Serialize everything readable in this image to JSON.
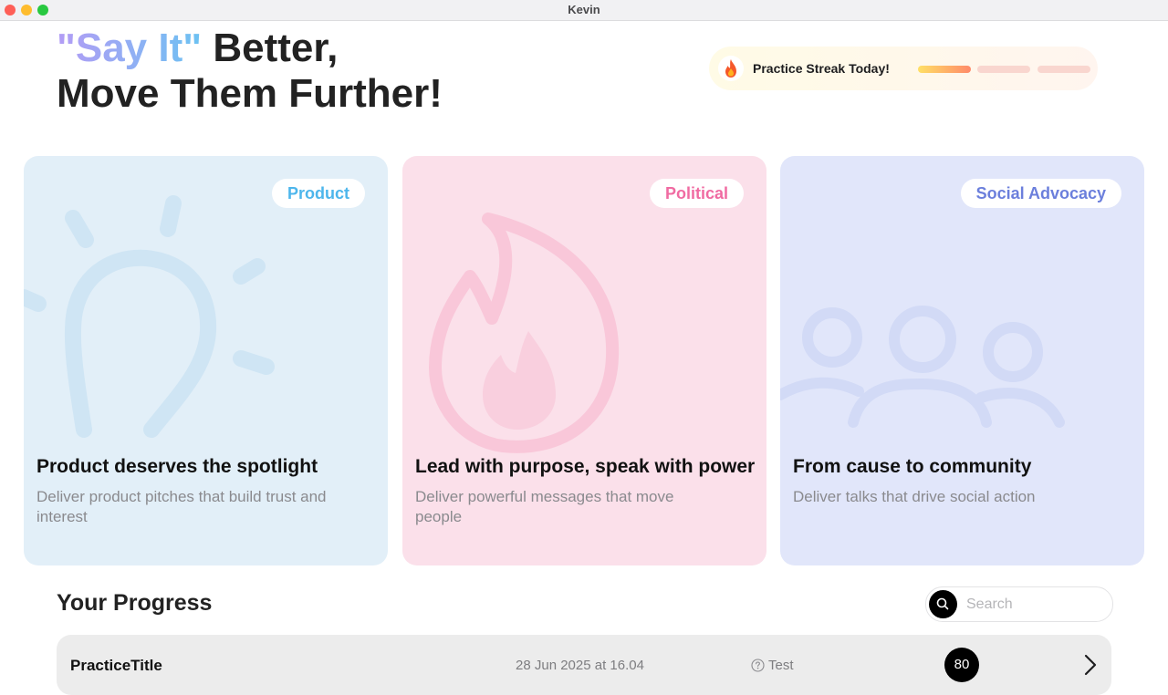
{
  "window": {
    "title": "Kevin"
  },
  "hero": {
    "highlight": "\"Say It\"",
    "line1_rest": " Better,",
    "line2": "Move Them Further!"
  },
  "streak": {
    "icon": "fire-icon",
    "label": "Practice Streak Today!",
    "segments_total": 3,
    "segments_completed": 1
  },
  "cards": [
    {
      "tag": "Product",
      "title": "Product deserves the spotlight",
      "subtitle": "Deliver product pitches that build trust and interest",
      "illustration": "lightbulb-icon",
      "accent": "#4db6ec"
    },
    {
      "tag": "Political",
      "title": "Lead with purpose, speak with power",
      "subtitle": "Deliver powerful messages that move people",
      "illustration": "flame-icon",
      "accent": "#f06ba2"
    },
    {
      "tag": "Social Advocacy",
      "title": "From cause to community",
      "subtitle": "Deliver talks that drive social action",
      "illustration": "people-icon",
      "accent": "#6b7fdc"
    }
  ],
  "progress": {
    "title": "Your Progress",
    "search": {
      "placeholder": "Search",
      "value": "",
      "icon": "search-icon"
    },
    "rows": [
      {
        "title": "PracticeTitle",
        "date": "28 Jun 2025 at 16.04",
        "type": "Test",
        "type_icon": "question-circle-icon",
        "score": "80"
      }
    ]
  }
}
